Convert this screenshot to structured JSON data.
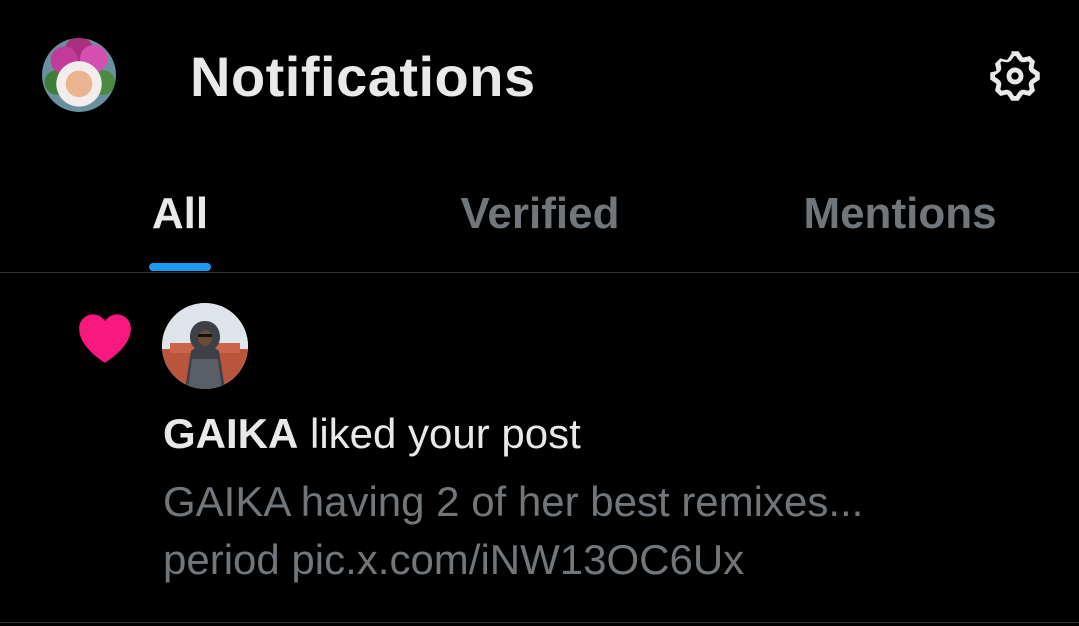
{
  "header": {
    "title": "Notifications",
    "avatar_icon": "profile-avatar",
    "settings_icon": "gear-icon"
  },
  "tabs": [
    {
      "label": "All",
      "active": true
    },
    {
      "label": "Verified",
      "active": false
    },
    {
      "label": "Mentions",
      "active": false
    }
  ],
  "notification": {
    "type_icon": "heart-icon",
    "type_color": "#f91880",
    "user_name": "GAIKA",
    "action_text": " liked your post",
    "post_line1": "GAIKA having 2 of her best remixes...",
    "post_line2": "period pic.x.com/iNW13OC6Ux"
  },
  "colors": {
    "background": "#000000",
    "primary_text": "#e7e9ea",
    "secondary_text": "#71767b",
    "accent": "#1d9bf0",
    "like": "#f91880",
    "divider": "#2f3336"
  }
}
